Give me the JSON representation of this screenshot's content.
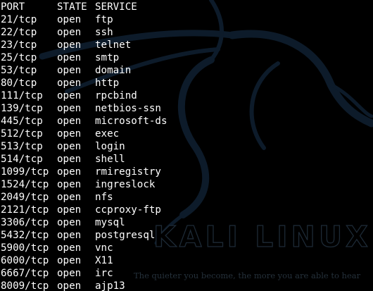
{
  "wallpaper": {
    "brand": "KALI LINUX",
    "tagline": "The quieter you become, the more you are able to hear",
    "colors": {
      "background": "#000000",
      "dragon": "#0d1b2a",
      "text": "#ffffff"
    }
  },
  "scan": {
    "headers": {
      "port": "PORT",
      "state": "STATE",
      "service": "SERVICE"
    },
    "rows": [
      {
        "port": "21/tcp",
        "state": "open",
        "service": "ftp"
      },
      {
        "port": "22/tcp",
        "state": "open",
        "service": "ssh"
      },
      {
        "port": "23/tcp",
        "state": "open",
        "service": "telnet"
      },
      {
        "port": "25/tcp",
        "state": "open",
        "service": "smtp"
      },
      {
        "port": "53/tcp",
        "state": "open",
        "service": "domain"
      },
      {
        "port": "80/tcp",
        "state": "open",
        "service": "http"
      },
      {
        "port": "111/tcp",
        "state": "open",
        "service": "rpcbind"
      },
      {
        "port": "139/tcp",
        "state": "open",
        "service": "netbios-ssn"
      },
      {
        "port": "445/tcp",
        "state": "open",
        "service": "microsoft-ds"
      },
      {
        "port": "512/tcp",
        "state": "open",
        "service": "exec"
      },
      {
        "port": "513/tcp",
        "state": "open",
        "service": "login"
      },
      {
        "port": "514/tcp",
        "state": "open",
        "service": "shell"
      },
      {
        "port": "1099/tcp",
        "state": "open",
        "service": "rmiregistry"
      },
      {
        "port": "1524/tcp",
        "state": "open",
        "service": "ingreslock"
      },
      {
        "port": "2049/tcp",
        "state": "open",
        "service": "nfs"
      },
      {
        "port": "2121/tcp",
        "state": "open",
        "service": "ccproxy-ftp"
      },
      {
        "port": "3306/tcp",
        "state": "open",
        "service": "mysql"
      },
      {
        "port": "5432/tcp",
        "state": "open",
        "service": "postgresql"
      },
      {
        "port": "5900/tcp",
        "state": "open",
        "service": "vnc"
      },
      {
        "port": "6000/tcp",
        "state": "open",
        "service": "X11"
      },
      {
        "port": "6667/tcp",
        "state": "open",
        "service": "irc"
      },
      {
        "port": "8009/tcp",
        "state": "open",
        "service": "ajp13"
      }
    ]
  }
}
